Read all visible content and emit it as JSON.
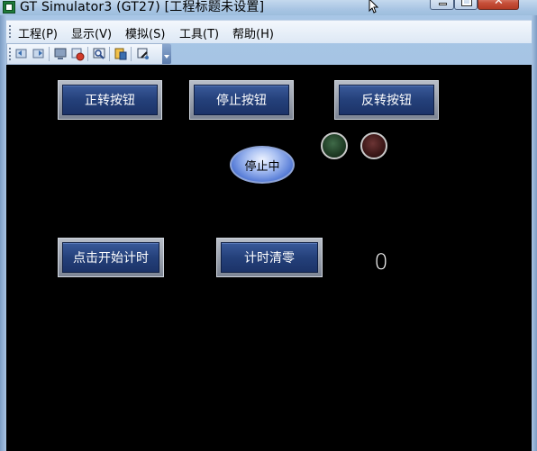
{
  "window": {
    "title": "GT Simulator3 (GT27)  [工程标题未设置]"
  },
  "menu": {
    "items": [
      {
        "label": "工程(P)"
      },
      {
        "label": "显示(V)"
      },
      {
        "label": "模拟(S)"
      },
      {
        "label": "工具(T)"
      },
      {
        "label": "帮助(H)"
      }
    ]
  },
  "toolbar": {
    "icons": [
      "undo-icon",
      "redo-icon",
      "screen-icon",
      "record-icon",
      "monitor-icon",
      "device-icon",
      "zoom-icon"
    ]
  },
  "hmi": {
    "buttons": {
      "forward": "正转按钮",
      "stop": "停止按钮",
      "reverse": "反转按钮",
      "start_timer": "点击开始计时",
      "clear_timer": "计时清零"
    },
    "status_label": "停止中",
    "counter_value": "0",
    "lamps": {
      "green_state": "off",
      "red_state": "off"
    }
  },
  "colors": {
    "screen_bg": "#000000",
    "button_face": "#2a4a8a",
    "lamp_green": "#1e3b24",
    "lamp_red": "#3a1616"
  }
}
